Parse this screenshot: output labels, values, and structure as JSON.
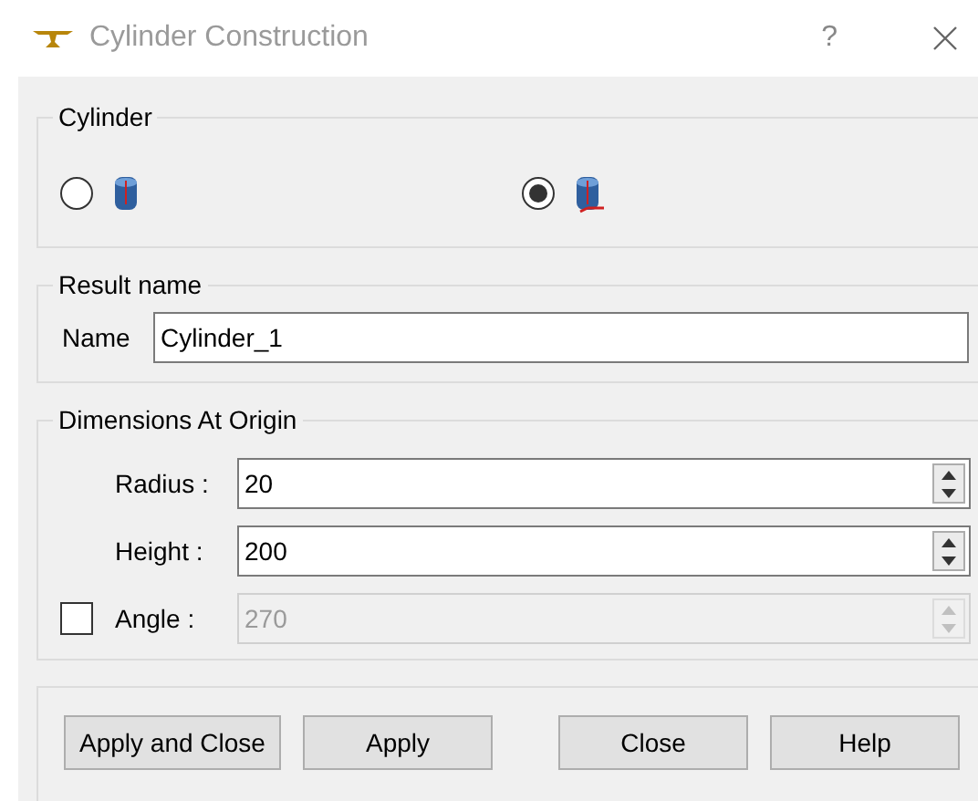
{
  "window": {
    "title": "Cylinder Construction",
    "help": "?"
  },
  "cylinder": {
    "title": "Cylinder",
    "options": [
      {
        "selected": false,
        "kind": "base"
      },
      {
        "selected": true,
        "kind": "axes"
      }
    ]
  },
  "result_name": {
    "title": "Result name",
    "label": "Name",
    "value": "Cylinder_1"
  },
  "dimensions": {
    "title": "Dimensions At Origin",
    "rows": [
      {
        "label": "Radius :",
        "value": "20",
        "disabled": false
      },
      {
        "label": "Height :",
        "value": "200",
        "disabled": false
      },
      {
        "label": "Angle :",
        "value": "270",
        "disabled": true,
        "checked": false
      }
    ]
  },
  "buttons": [
    "Apply and Close",
    "Apply",
    "Close",
    "Help"
  ]
}
